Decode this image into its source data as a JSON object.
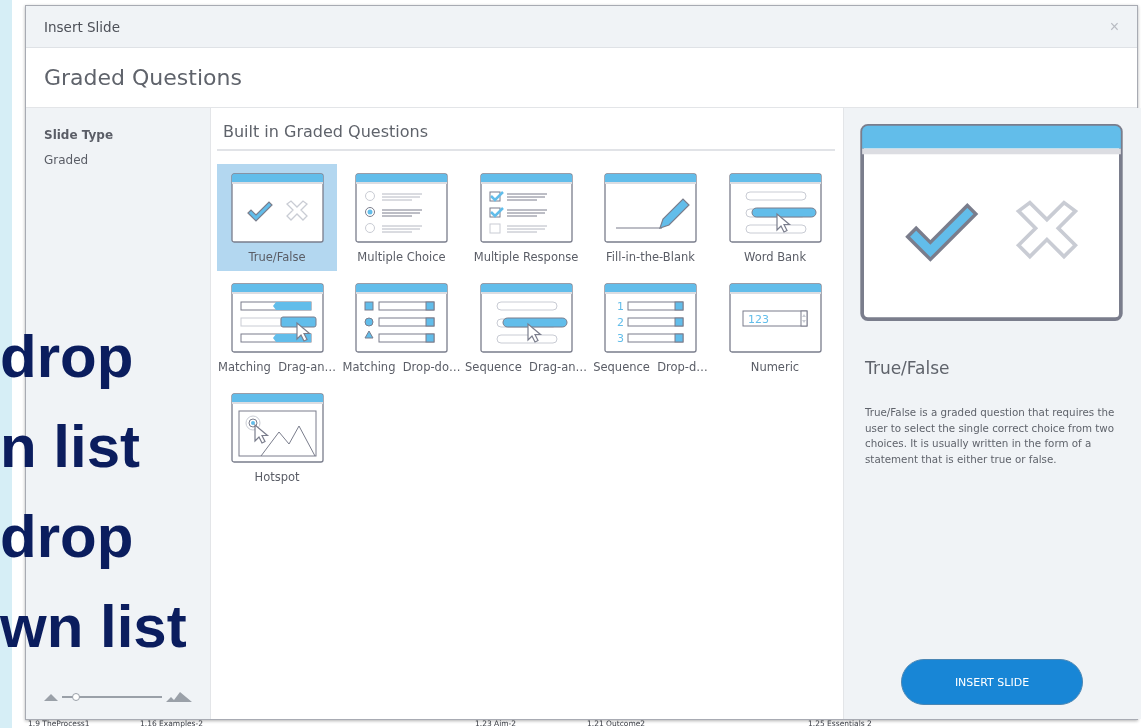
{
  "dialog": {
    "title": "Insert Slide",
    "close": "×",
    "heading": "Graded Questions"
  },
  "sidebar": {
    "label": "Slide Type",
    "items": [
      "Graded"
    ],
    "zoom_slider": {
      "level": 0.14
    }
  },
  "gallery": {
    "title": "Built in Graded Questions",
    "tiles": [
      {
        "kind": "true_false",
        "label": "True/False",
        "selected": true
      },
      {
        "kind": "multiple_choice",
        "label": "Multiple Choice",
        "selected": false
      },
      {
        "kind": "multiple_response",
        "label": "Multiple Response",
        "selected": false
      },
      {
        "kind": "fill_blank",
        "label": "Fill-in-the-Blank",
        "selected": false
      },
      {
        "kind": "word_bank",
        "label": "Word Bank",
        "selected": false
      },
      {
        "kind": "matching_drag",
        "label": "Matching  Drag-an…",
        "selected": false
      },
      {
        "kind": "matching_drop",
        "label": "Matching  Drop-do…",
        "selected": false
      },
      {
        "kind": "sequence_drag",
        "label": "Sequence  Drag-an…",
        "selected": false
      },
      {
        "kind": "sequence_drop",
        "label": "Sequence  Drop-d…",
        "selected": false,
        "icon_numbers": [
          "1",
          "2",
          "3"
        ]
      },
      {
        "kind": "numeric",
        "label": "Numeric",
        "selected": false,
        "icon_text": "123"
      },
      {
        "kind": "hotspot",
        "label": "Hotspot",
        "selected": false
      }
    ]
  },
  "preview": {
    "kind": "true_false",
    "title": "True/False",
    "description": "True/False is a graded question that requires the user to select the single correct choice from two choices.  It is usually written in the form of a statement that is either true or false."
  },
  "insert_button": "INSERT SLIDE",
  "overlay_text": [
    "drop",
    "n list",
    "drop",
    "wn list"
  ],
  "filmstrip": [
    "1.9 TheProcess1",
    "1.16 Examples-2",
    "1.23 Aim-2",
    "1.21 Outcome2",
    "1.25 Essentials 2"
  ]
}
